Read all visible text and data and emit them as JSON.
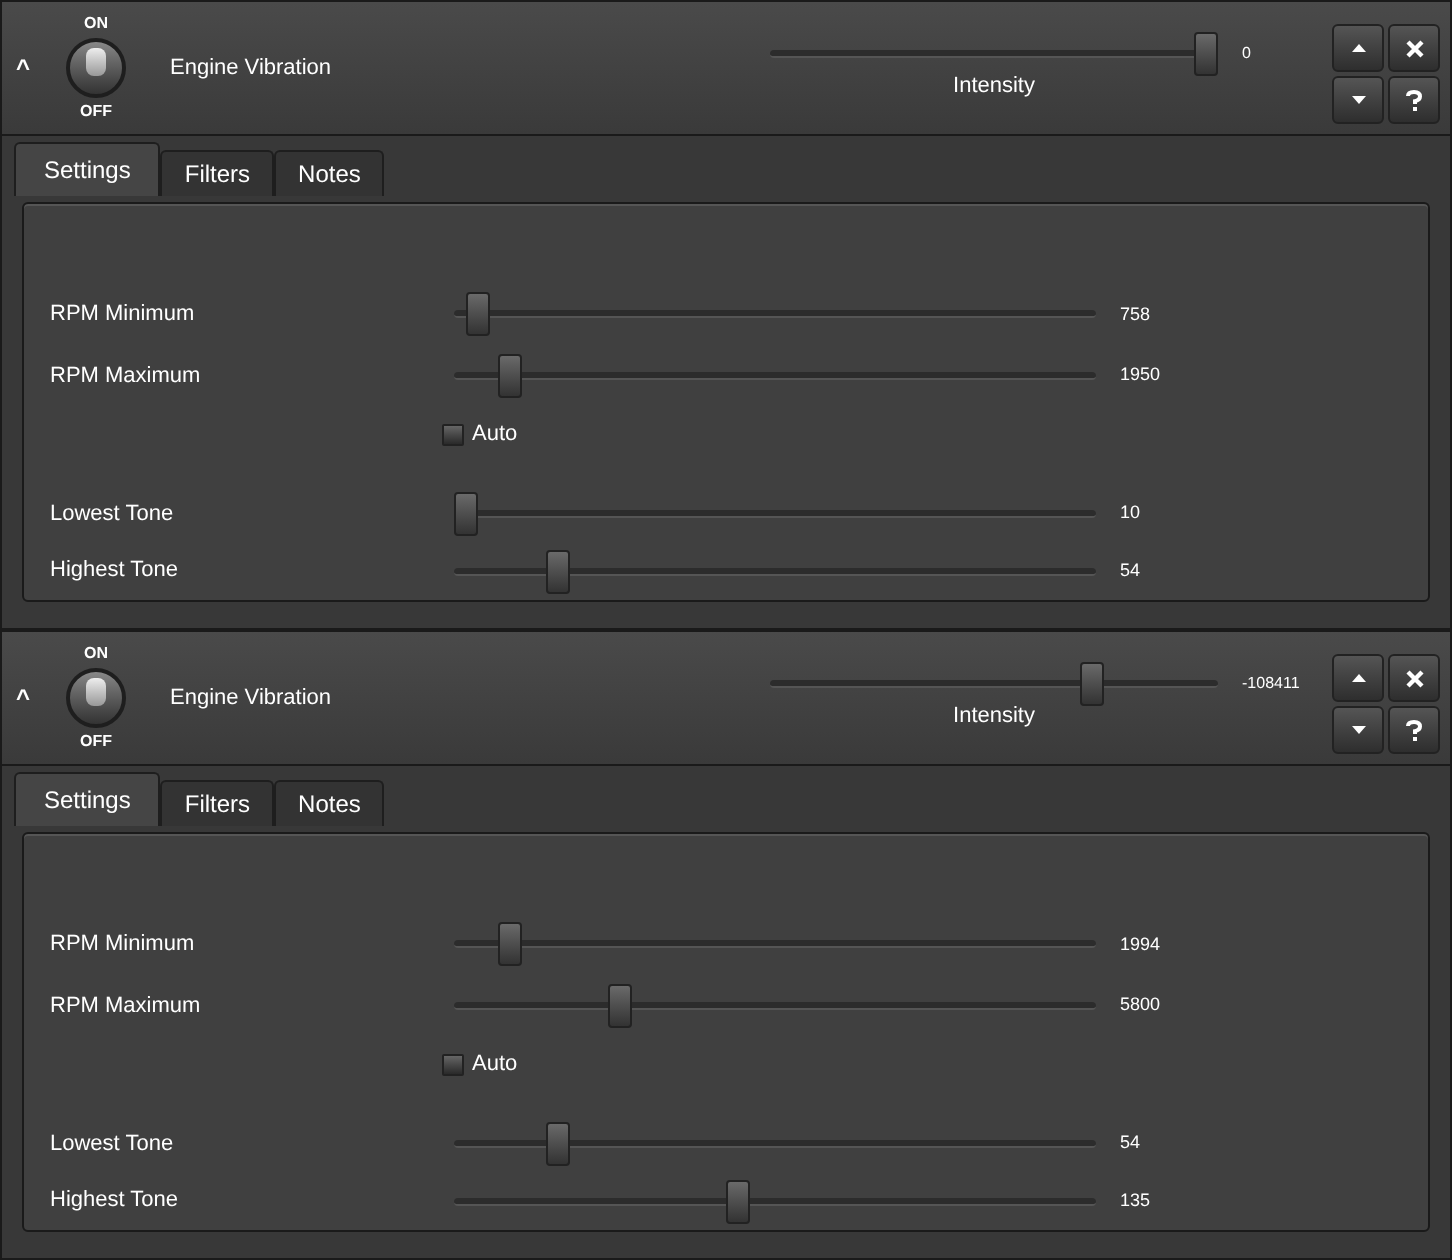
{
  "panels": [
    {
      "collapse_icon": "^",
      "toggle": {
        "on_label": "ON",
        "off_label": "OFF",
        "on": true
      },
      "title": "Engine Vibration",
      "intensity": {
        "label": "Intensity",
        "level": 1,
        "reading": "0"
      },
      "tabs": [
        {
          "label": "Settings",
          "selected": true
        },
        {
          "label": "Filters",
          "selected": false
        },
        {
          "label": "Notes",
          "selected": false
        }
      ],
      "sliders": [
        {
          "label": "RPM Minimum",
          "level": 0.02,
          "reading": "758"
        },
        {
          "label": "RPM Maximum",
          "level": 0.07,
          "reading": "1950"
        }
      ],
      "auto": {
        "label": "Auto",
        "checked": false
      },
      "tone_sliders": [
        {
          "label": "Lowest Tone",
          "level": 0,
          "reading": "10"
        },
        {
          "label": "Highest Tone",
          "level": 0.15,
          "reading": "54"
        }
      ]
    },
    {
      "collapse_icon": "^",
      "toggle": {
        "on_label": "ON",
        "off_label": "OFF",
        "on": true
      },
      "title": "Engine Vibration",
      "intensity": {
        "label": "Intensity",
        "level": 0.73,
        "reading": "-108411"
      },
      "tabs": [
        {
          "label": "Settings",
          "selected": true
        },
        {
          "label": "Filters",
          "selected": false
        },
        {
          "label": "Notes",
          "selected": false
        }
      ],
      "sliders": [
        {
          "label": "RPM Minimum",
          "level": 0.07,
          "reading": "1994"
        },
        {
          "label": "RPM Maximum",
          "level": 0.25,
          "reading": "5800"
        }
      ],
      "auto": {
        "label": "Auto",
        "checked": false
      },
      "tone_sliders": [
        {
          "label": "Lowest Tone",
          "level": 0.15,
          "reading": "54"
        },
        {
          "label": "Highest Tone",
          "level": 0.44,
          "reading": "135"
        }
      ]
    }
  ]
}
